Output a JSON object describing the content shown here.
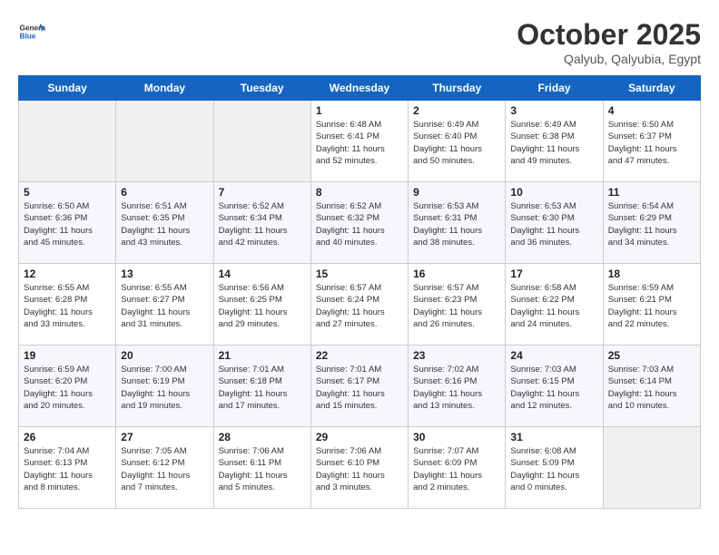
{
  "header": {
    "logo_general": "General",
    "logo_blue": "Blue",
    "month": "October 2025",
    "location": "Qalyub, Qalyubia, Egypt"
  },
  "weekdays": [
    "Sunday",
    "Monday",
    "Tuesday",
    "Wednesday",
    "Thursday",
    "Friday",
    "Saturday"
  ],
  "weeks": [
    [
      {
        "day": "",
        "info": ""
      },
      {
        "day": "",
        "info": ""
      },
      {
        "day": "",
        "info": ""
      },
      {
        "day": "1",
        "info": "Sunrise: 6:48 AM\nSunset: 6:41 PM\nDaylight: 11 hours\nand 52 minutes."
      },
      {
        "day": "2",
        "info": "Sunrise: 6:49 AM\nSunset: 6:40 PM\nDaylight: 11 hours\nand 50 minutes."
      },
      {
        "day": "3",
        "info": "Sunrise: 6:49 AM\nSunset: 6:38 PM\nDaylight: 11 hours\nand 49 minutes."
      },
      {
        "day": "4",
        "info": "Sunrise: 6:50 AM\nSunset: 6:37 PM\nDaylight: 11 hours\nand 47 minutes."
      }
    ],
    [
      {
        "day": "5",
        "info": "Sunrise: 6:50 AM\nSunset: 6:36 PM\nDaylight: 11 hours\nand 45 minutes."
      },
      {
        "day": "6",
        "info": "Sunrise: 6:51 AM\nSunset: 6:35 PM\nDaylight: 11 hours\nand 43 minutes."
      },
      {
        "day": "7",
        "info": "Sunrise: 6:52 AM\nSunset: 6:34 PM\nDaylight: 11 hours\nand 42 minutes."
      },
      {
        "day": "8",
        "info": "Sunrise: 6:52 AM\nSunset: 6:32 PM\nDaylight: 11 hours\nand 40 minutes."
      },
      {
        "day": "9",
        "info": "Sunrise: 6:53 AM\nSunset: 6:31 PM\nDaylight: 11 hours\nand 38 minutes."
      },
      {
        "day": "10",
        "info": "Sunrise: 6:53 AM\nSunset: 6:30 PM\nDaylight: 11 hours\nand 36 minutes."
      },
      {
        "day": "11",
        "info": "Sunrise: 6:54 AM\nSunset: 6:29 PM\nDaylight: 11 hours\nand 34 minutes."
      }
    ],
    [
      {
        "day": "12",
        "info": "Sunrise: 6:55 AM\nSunset: 6:28 PM\nDaylight: 11 hours\nand 33 minutes."
      },
      {
        "day": "13",
        "info": "Sunrise: 6:55 AM\nSunset: 6:27 PM\nDaylight: 11 hours\nand 31 minutes."
      },
      {
        "day": "14",
        "info": "Sunrise: 6:56 AM\nSunset: 6:25 PM\nDaylight: 11 hours\nand 29 minutes."
      },
      {
        "day": "15",
        "info": "Sunrise: 6:57 AM\nSunset: 6:24 PM\nDaylight: 11 hours\nand 27 minutes."
      },
      {
        "day": "16",
        "info": "Sunrise: 6:57 AM\nSunset: 6:23 PM\nDaylight: 11 hours\nand 26 minutes."
      },
      {
        "day": "17",
        "info": "Sunrise: 6:58 AM\nSunset: 6:22 PM\nDaylight: 11 hours\nand 24 minutes."
      },
      {
        "day": "18",
        "info": "Sunrise: 6:59 AM\nSunset: 6:21 PM\nDaylight: 11 hours\nand 22 minutes."
      }
    ],
    [
      {
        "day": "19",
        "info": "Sunrise: 6:59 AM\nSunset: 6:20 PM\nDaylight: 11 hours\nand 20 minutes."
      },
      {
        "day": "20",
        "info": "Sunrise: 7:00 AM\nSunset: 6:19 PM\nDaylight: 11 hours\nand 19 minutes."
      },
      {
        "day": "21",
        "info": "Sunrise: 7:01 AM\nSunset: 6:18 PM\nDaylight: 11 hours\nand 17 minutes."
      },
      {
        "day": "22",
        "info": "Sunrise: 7:01 AM\nSunset: 6:17 PM\nDaylight: 11 hours\nand 15 minutes."
      },
      {
        "day": "23",
        "info": "Sunrise: 7:02 AM\nSunset: 6:16 PM\nDaylight: 11 hours\nand 13 minutes."
      },
      {
        "day": "24",
        "info": "Sunrise: 7:03 AM\nSunset: 6:15 PM\nDaylight: 11 hours\nand 12 minutes."
      },
      {
        "day": "25",
        "info": "Sunrise: 7:03 AM\nSunset: 6:14 PM\nDaylight: 11 hours\nand 10 minutes."
      }
    ],
    [
      {
        "day": "26",
        "info": "Sunrise: 7:04 AM\nSunset: 6:13 PM\nDaylight: 11 hours\nand 8 minutes."
      },
      {
        "day": "27",
        "info": "Sunrise: 7:05 AM\nSunset: 6:12 PM\nDaylight: 11 hours\nand 7 minutes."
      },
      {
        "day": "28",
        "info": "Sunrise: 7:06 AM\nSunset: 6:11 PM\nDaylight: 11 hours\nand 5 minutes."
      },
      {
        "day": "29",
        "info": "Sunrise: 7:06 AM\nSunset: 6:10 PM\nDaylight: 11 hours\nand 3 minutes."
      },
      {
        "day": "30",
        "info": "Sunrise: 7:07 AM\nSunset: 6:09 PM\nDaylight: 11 hours\nand 2 minutes."
      },
      {
        "day": "31",
        "info": "Sunrise: 6:08 AM\nSunset: 5:09 PM\nDaylight: 11 hours\nand 0 minutes."
      },
      {
        "day": "",
        "info": ""
      }
    ]
  ]
}
